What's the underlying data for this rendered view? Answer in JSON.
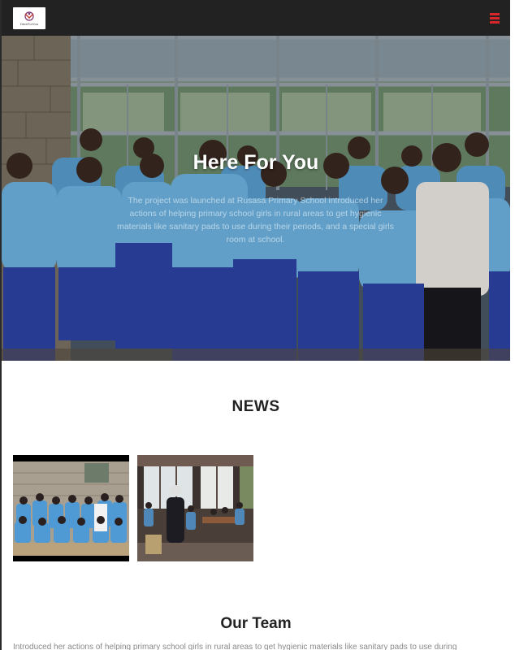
{
  "navbar": {
    "logo_text": "HereForYou",
    "menu_icon": "hamburger-menu-icon",
    "menu_color": "#d9262b"
  },
  "hero": {
    "title": "Here For You",
    "body": "The project was launched at Rusasa Primary School introduced her actions of helping primary school girls in rural areas to get hygienic materials like sanitary pads to use during their periods, and a special girls room at school."
  },
  "news": {
    "heading": "NEWS",
    "items": [
      {
        "image": "school-girls-group-photo"
      },
      {
        "image": "classroom-presentation-photo"
      }
    ]
  },
  "team": {
    "heading": "Our Team",
    "text": "Introduced her actions of helping primary school girls in rural areas to get hygienic materials like sanitary pads to use during"
  }
}
